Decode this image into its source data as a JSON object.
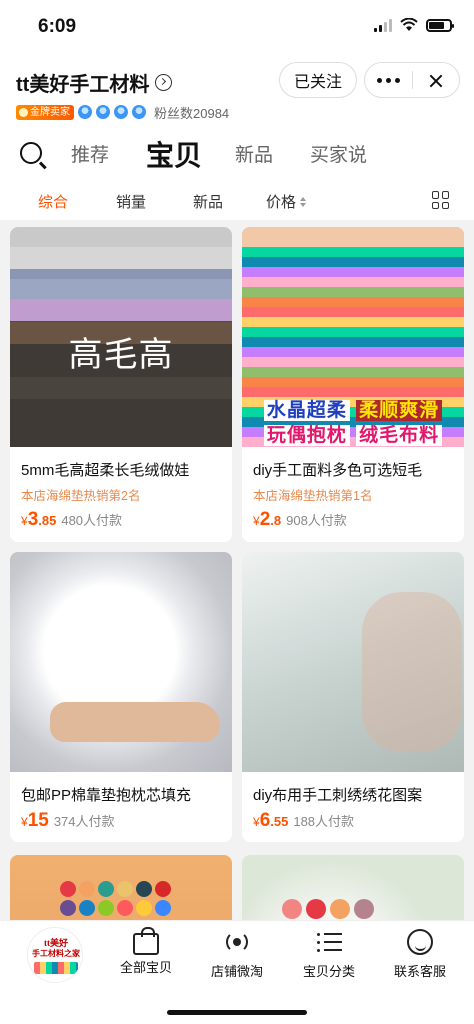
{
  "status_bar": {
    "time": "6:09"
  },
  "shop": {
    "name": "tt美好手工材料",
    "follow_label": "已关注",
    "badge_label": "金牌卖家",
    "fans": "粉丝数20984"
  },
  "tabs": [
    "推荐",
    "宝贝",
    "新品",
    "买家说"
  ],
  "active_tab": "宝贝",
  "sort": {
    "items": [
      "综合",
      "销量",
      "新品",
      "价格"
    ],
    "active": "综合"
  },
  "products": [
    {
      "title": "5mm毛高超柔长毛绒做娃",
      "rank": "本店海绵垫热销第2名",
      "price_symbol": "¥",
      "price_int": "3",
      "price_dec": ".85",
      "paid": "480人付款",
      "overlay_text": "高毛高"
    },
    {
      "title": "diy手工面料多色可选短毛",
      "rank": "本店海绵垫热销第1名",
      "price_symbol": "¥",
      "price_int": "2",
      "price_dec": ".8",
      "paid": "908人付款",
      "promo_1a": "水晶超柔",
      "promo_1b": "柔顺爽滑",
      "promo_2a": "玩偶抱枕",
      "promo_2b": "绒毛布料"
    },
    {
      "title": "包邮PP棉靠垫抱枕芯填充",
      "price_symbol": "¥",
      "price_int": "15",
      "price_dec": "",
      "paid": "374人付款"
    },
    {
      "title": "diy布用手工刺绣绣花图案",
      "price_symbol": "¥",
      "price_int": "6",
      "price_dec": ".55",
      "paid": "188人付款"
    }
  ],
  "bottom_nav": {
    "avatar_text_1": "tt美好",
    "avatar_text_2": "手工材料之家",
    "items": [
      "全部宝贝",
      "店铺微淘",
      "宝贝分类",
      "联系客服"
    ]
  },
  "colors": {
    "accent": "#ff5000",
    "rank_text": "#e58a4e"
  }
}
